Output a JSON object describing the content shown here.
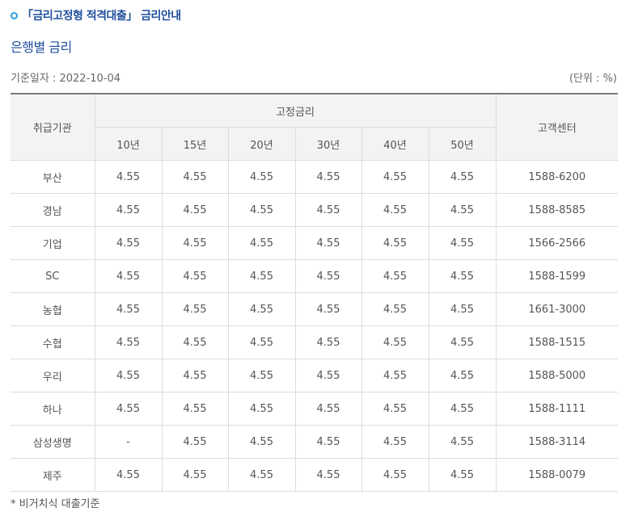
{
  "header": {
    "title": "「금리고정형 적격대출」 금리안내",
    "section_title": "은행별 금리",
    "base_date": "기준일자 : 2022-10-04",
    "unit": "(단위 : %)"
  },
  "table": {
    "col_institution": "취급기관",
    "group_fixed": "고정금리",
    "col_center": "고객센터",
    "terms": [
      "10년",
      "15년",
      "20년",
      "30년",
      "40년",
      "50년"
    ],
    "rows": [
      {
        "bank": "부산",
        "rates": [
          "4.55",
          "4.55",
          "4.55",
          "4.55",
          "4.55",
          "4.55"
        ],
        "phone": "1588-6200"
      },
      {
        "bank": "경남",
        "rates": [
          "4.55",
          "4.55",
          "4.55",
          "4.55",
          "4.55",
          "4.55"
        ],
        "phone": "1588-8585"
      },
      {
        "bank": "기업",
        "rates": [
          "4.55",
          "4.55",
          "4.55",
          "4.55",
          "4.55",
          "4.55"
        ],
        "phone": "1566-2566"
      },
      {
        "bank": "SC",
        "rates": [
          "4.55",
          "4.55",
          "4.55",
          "4.55",
          "4.55",
          "4.55"
        ],
        "phone": "1588-1599"
      },
      {
        "bank": "농협",
        "rates": [
          "4.55",
          "4.55",
          "4.55",
          "4.55",
          "4.55",
          "4.55"
        ],
        "phone": "1661-3000"
      },
      {
        "bank": "수협",
        "rates": [
          "4.55",
          "4.55",
          "4.55",
          "4.55",
          "4.55",
          "4.55"
        ],
        "phone": "1588-1515"
      },
      {
        "bank": "우리",
        "rates": [
          "4.55",
          "4.55",
          "4.55",
          "4.55",
          "4.55",
          "4.55"
        ],
        "phone": "1588-5000"
      },
      {
        "bank": "하나",
        "rates": [
          "4.55",
          "4.55",
          "4.55",
          "4.55",
          "4.55",
          "4.55"
        ],
        "phone": "1588-1111"
      },
      {
        "bank": "삼성생명",
        "rates": [
          "-",
          "4.55",
          "4.55",
          "4.55",
          "4.55",
          "4.55"
        ],
        "phone": "1588-3114"
      },
      {
        "bank": "제주",
        "rates": [
          "4.55",
          "4.55",
          "4.55",
          "4.55",
          "4.55",
          "4.55"
        ],
        "phone": "1588-0079"
      }
    ]
  },
  "footnote": "* 비거치식 대출기준",
  "colors": {
    "title": "#1f4e9c",
    "bullet": "#2aa1d9",
    "header_bg": "#f3f3f3",
    "border": "#dcdcdc"
  },
  "icons": {
    "title_bullet": "circle-bullet-icon"
  }
}
